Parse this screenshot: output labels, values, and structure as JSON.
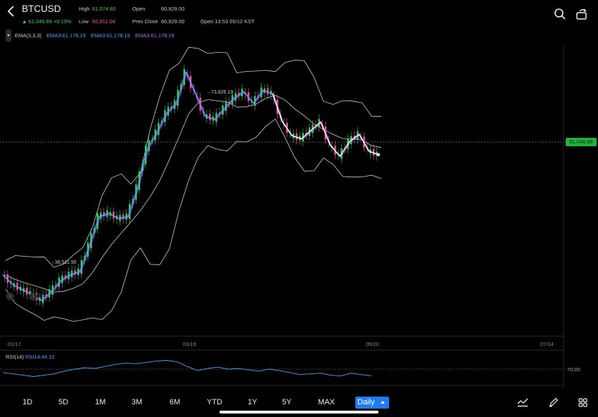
{
  "header": {
    "symbol": "BTCUSD",
    "last_price_change": "▲ 61,046.89 +0.19%",
    "high_label": "High",
    "high_value": "61,074.80",
    "low_label": "Low",
    "low_value": "60,911.04",
    "open_label": "Open",
    "open_value": "60,929.00",
    "prev_close_label": "Prev Close",
    "prev_close_value": "60,929.00",
    "open_time": "Open 13:53 05/12 KST"
  },
  "indicators": {
    "ema_label": "EMA(3,3,3)",
    "ema_values": [
      "EMA3:61,178.19",
      "EMA3:61,178.19",
      "EMA3:61,178.19"
    ],
    "rsi_label": "RSI(14)",
    "rsi_value": "RSI14:44.12",
    "rsi_level_label": "70.00"
  },
  "price_tag": "61,046.89",
  "annotations": {
    "high": "73,826.19",
    "low": "38,511.90"
  },
  "x_axis": {
    "labels": [
      "01/17",
      "03/19",
      "05/20",
      "07/14"
    ]
  },
  "timeframes": [
    "1D",
    "5D",
    "1M",
    "3M",
    "6M",
    "YTD",
    "1Y",
    "5Y",
    "MAX"
  ],
  "active_timeframe": "Daily",
  "colors": {
    "up": "#39d353",
    "down": "#ff4fa3",
    "ema_blue": "#4ba3ff",
    "ema_purple": "#b266ff",
    "accent": "#1e7bf2",
    "price_tag": "#1fb141"
  },
  "chart_data": {
    "type": "line",
    "title": "",
    "x": [
      "01/17",
      "03/19",
      "05/20",
      "07/14"
    ],
    "series": [
      {
        "values": [
          42500,
          41000,
          40200,
          39500,
          38511.9,
          39800,
          41600,
          42500,
          43000,
          47000,
          51500,
          52000,
          51200,
          51500,
          56000,
          62000,
          64500,
          67500,
          69000,
          73826.19,
          70500,
          67000,
          66500,
          68200,
          69800,
          70800,
          69000,
          71000,
          70500,
          66200,
          64000,
          63500,
          64800,
          66100,
          62500,
          60800,
          63100,
          64200,
          61600,
          61046.89
        ]
      }
    ],
    "price_markers": {
      "high": 73826.19,
      "low": 38511.9,
      "last": 61046.89
    },
    "rsi": {
      "level": 70,
      "values": [
        49,
        47,
        45,
        43,
        45,
        47,
        51,
        54,
        56,
        55,
        58,
        61,
        63,
        62,
        64,
        66,
        67,
        65,
        58,
        52,
        55,
        57,
        54,
        55,
        53,
        51,
        54,
        52,
        49,
        46,
        47,
        48,
        45,
        44,
        48,
        46,
        44.12
      ]
    }
  }
}
